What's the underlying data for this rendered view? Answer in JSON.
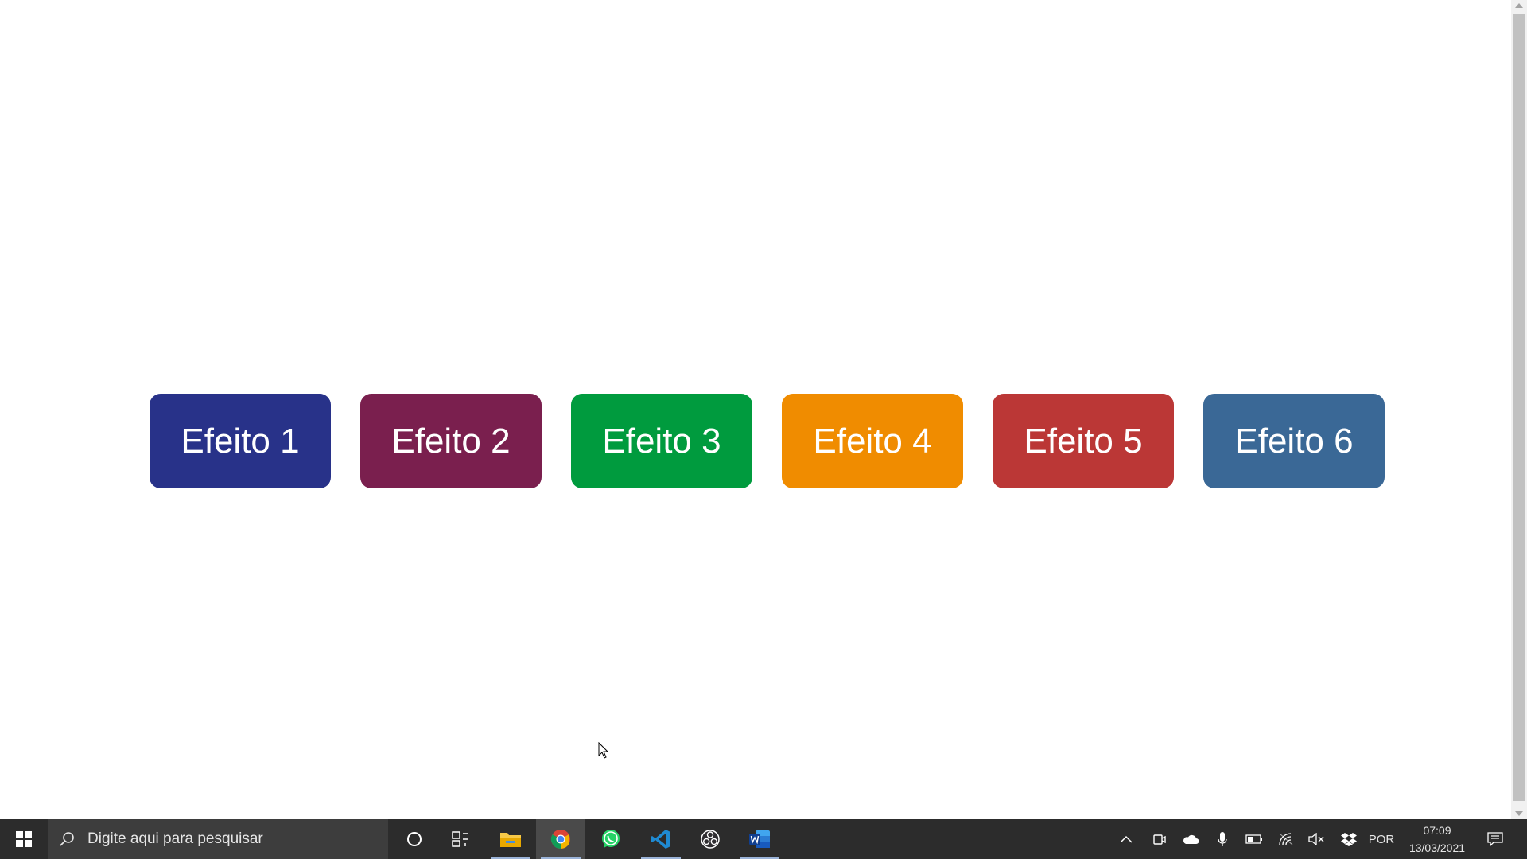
{
  "buttons": [
    {
      "label": "Efeito 1",
      "color": "#283289"
    },
    {
      "label": "Efeito 2",
      "color": "#7a1f4e"
    },
    {
      "label": "Efeito 3",
      "color": "#009b3e"
    },
    {
      "label": "Efeito 4",
      "color": "#f08c00"
    },
    {
      "label": "Efeito 5",
      "color": "#bb3736"
    },
    {
      "label": "Efeito 6",
      "color": "#3a6896"
    }
  ],
  "taskbar": {
    "search_placeholder": "Digite aqui para pesquisar",
    "apps": [
      "file-explorer",
      "chrome",
      "whatsapp",
      "vscode",
      "obs-studio",
      "word"
    ],
    "language": "POR",
    "time": "07:09",
    "date": "13/03/2021"
  }
}
